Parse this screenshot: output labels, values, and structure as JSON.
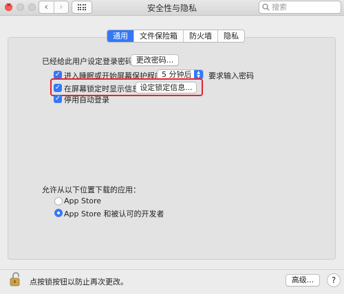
{
  "window": {
    "title": "安全性与隐私",
    "search_placeholder": "搜索"
  },
  "tabs": [
    {
      "label": "通用",
      "active": true
    },
    {
      "label": "文件保险箱",
      "active": false
    },
    {
      "label": "防火墙",
      "active": false
    },
    {
      "label": "隐私",
      "active": false
    }
  ],
  "general": {
    "password_set_label": "已经给此用户设定登录密码",
    "change_password_button": "更改密码...",
    "require_password": {
      "checked": true,
      "prefix": "进入睡眠或开始屏幕保护程序",
      "delay_value": "5 分钟后",
      "suffix": "要求输入密码"
    },
    "show_message": {
      "checked": true,
      "label": "在屏幕锁定时显示信息",
      "button": "设定锁定信息..."
    },
    "disable_auto_login": {
      "checked": true,
      "label": "停用自动登录"
    }
  },
  "downloads": {
    "label": "允许从以下位置下载的应用：",
    "options": [
      {
        "label": "App Store",
        "selected": false
      },
      {
        "label": "App Store 和被认可的开发者",
        "selected": true
      }
    ]
  },
  "footer": {
    "lock_text": "点按锁按钮以防止再次更改。",
    "advanced_button": "高级...",
    "help_button": "?"
  },
  "colors": {
    "accent": "#3478f6",
    "highlight_box": "#e5232e",
    "close_button": "#ff5f57"
  },
  "icons": [
    "close-icon",
    "chevron-left-icon",
    "chevron-right-icon",
    "grid-icon",
    "search-icon",
    "checkmark-icon",
    "updown-arrows-icon",
    "lock-icon"
  ]
}
